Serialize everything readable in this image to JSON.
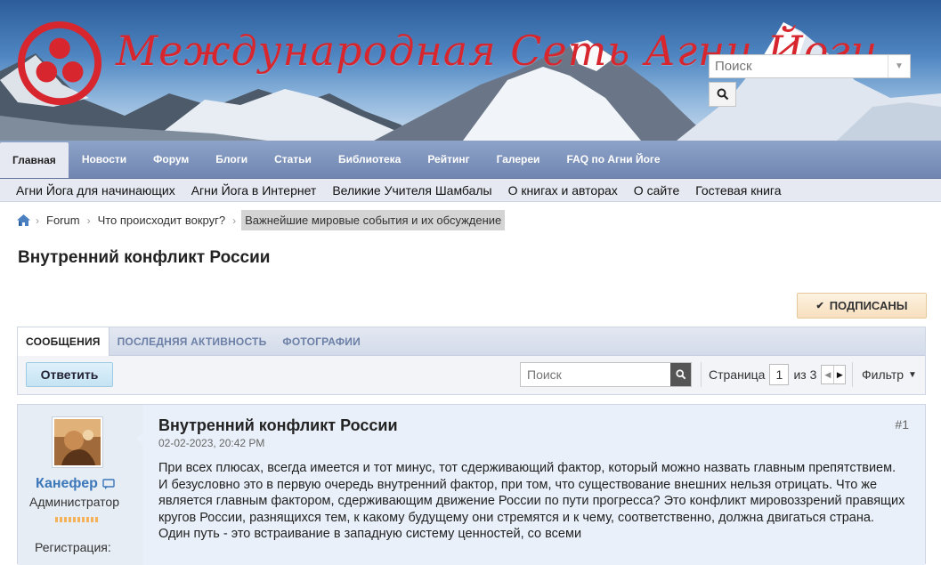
{
  "header": {
    "site_title": "Международная Сеть Агни Йоги",
    "search_placeholder": "Поиск",
    "brand_color": "#d8262e"
  },
  "main_nav": [
    {
      "label": "Главная",
      "active": true
    },
    {
      "label": "Новости"
    },
    {
      "label": "Форум"
    },
    {
      "label": "Блоги"
    },
    {
      "label": "Статьи"
    },
    {
      "label": "Библиотека"
    },
    {
      "label": "Рейтинг"
    },
    {
      "label": "Галереи"
    },
    {
      "label": "FAQ по Агни Йоге"
    }
  ],
  "sub_nav": [
    "Агни Йога для начинающих",
    "Агни Йога в Интернет",
    "Великие Учителя Шамбалы",
    "О книгах и авторах",
    "О сайте",
    "Гостевая книга"
  ],
  "breadcrumb": [
    "Forum",
    "Что происходит вокруг?",
    "Важнейшие мировые события и их обсуждение"
  ],
  "page_title": "Внутренний конфликт России",
  "subscribe_label": "ПОДПИСАНЫ",
  "tabs": [
    "СООБЩЕНИЯ",
    "ПОСЛЕДНЯЯ АКТИВНОСТЬ",
    "ФОТОГРАФИИ"
  ],
  "toolbar": {
    "reply_label": "Ответить",
    "search_placeholder": "Поиск",
    "page_label": "Страница",
    "page_current": "1",
    "page_of": "из 3",
    "filter_label": "Фильтр"
  },
  "post": {
    "title": "Внутренний конфликт России",
    "number": "#1",
    "date": "02-02-2023, 20:42 PM",
    "author": "Канефер",
    "role": "Администратор",
    "registration_label": "Регистрация:",
    "paragraphs": [
      "При всех плюсах, всегда имеется и тот минус, тот сдерживающий фактор, который можно назвать главным препятствием.",
      "И безусловно это в первую очередь внутренний фактор, при том, что существование внешних нельзя отрицать. Что же является главным фактором, сдерживающим движение России по пути прогресса? Это конфликт мировоззрений правящих кругов России, разнящихся тем, к какому будущему они стремятся и к чему, соответственно, должна двигаться страна. Один путь - это встраивание в западную систему ценностей, со всеми"
    ]
  },
  "icons": {
    "home": "home-icon",
    "search": "search-icon",
    "check": "check-icon",
    "chat": "speech-bubble-icon"
  }
}
